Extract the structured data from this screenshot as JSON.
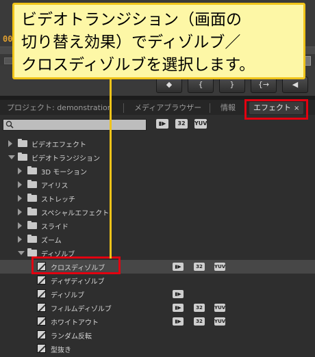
{
  "callout": {
    "text": "ビデオトランジション（画面の\n切り替え効果）でディゾルブ／\nクロスディゾルブを選択します。"
  },
  "monitor": {
    "timecode": "00",
    "buttons": [
      "◆",
      "{",
      "}",
      "{→",
      "◀"
    ]
  },
  "tabs": [
    {
      "label": "プロジェクト: demonstration",
      "active": false
    },
    {
      "label": "メディアブラウザー",
      "active": false
    },
    {
      "label": "情報",
      "active": false
    },
    {
      "label": "エフェクト",
      "active": true,
      "close": "×"
    }
  ],
  "effects_panel": {
    "search_value": "",
    "filter_badges": [
      "▮▶",
      "32",
      "YUV"
    ],
    "tree": [
      {
        "label": "ビデオエフェクト",
        "type": "folder",
        "level": 0,
        "expanded": false
      },
      {
        "label": "ビデオトランジション",
        "type": "folder",
        "level": 0,
        "expanded": true
      },
      {
        "label": "3D モーション",
        "type": "folder",
        "level": 1,
        "expanded": false
      },
      {
        "label": "アイリス",
        "type": "folder",
        "level": 1,
        "expanded": false
      },
      {
        "label": "ストレッチ",
        "type": "folder",
        "level": 1,
        "expanded": false
      },
      {
        "label": "スペシャルエフェクト",
        "type": "folder",
        "level": 1,
        "expanded": false
      },
      {
        "label": "スライド",
        "type": "folder",
        "level": 1,
        "expanded": false
      },
      {
        "label": "ズーム",
        "type": "folder",
        "level": 1,
        "expanded": false
      },
      {
        "label": "ディゾルブ",
        "type": "folder",
        "level": 1,
        "expanded": true
      },
      {
        "label": "クロスディゾルブ",
        "type": "item",
        "level": 2,
        "selected": true,
        "badges": [
          "▮▶",
          "32",
          "YUV"
        ]
      },
      {
        "label": "ディザディゾルブ",
        "type": "item",
        "level": 2,
        "badges": []
      },
      {
        "label": "ディゾルブ",
        "type": "item",
        "level": 2,
        "badges": [
          "▮▶"
        ]
      },
      {
        "label": "フィルムディゾルブ",
        "type": "item",
        "level": 2,
        "badges": [
          "▮▶",
          "32",
          "YUV"
        ]
      },
      {
        "label": "ホワイトアウト",
        "type": "item",
        "level": 2,
        "badges": [
          "▮▶",
          "32",
          "YUV"
        ]
      },
      {
        "label": "ランダム反転",
        "type": "item",
        "level": 2,
        "badges": []
      },
      {
        "label": "型抜き",
        "type": "item",
        "level": 2,
        "badges": []
      }
    ]
  },
  "colors": {
    "highlight": "#e20010",
    "callout_bg": "#fdf7a6",
    "callout_border": "#f0c419"
  }
}
